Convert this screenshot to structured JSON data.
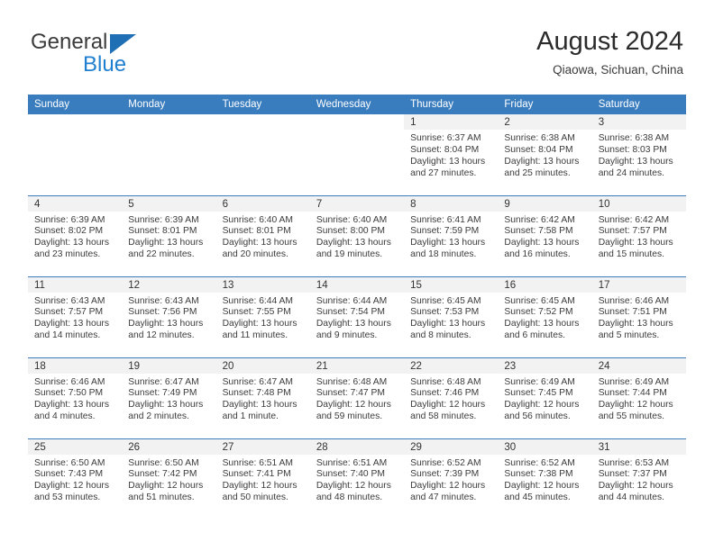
{
  "brand": {
    "line1": "General",
    "line2": "Blue",
    "triangle_icon": "brand-triangle-icon",
    "color_blue": "#1f7fd0",
    "color_dark": "#3b3b3b"
  },
  "header": {
    "title": "August 2024",
    "subtitle": "Qiaowa, Sichuan, China"
  },
  "theme": {
    "header_blue": "#3a7dbf",
    "daynum_bg": "#f2f2f2",
    "text": "#3b3b3b"
  },
  "weekdays": [
    "Sunday",
    "Monday",
    "Tuesday",
    "Wednesday",
    "Thursday",
    "Friday",
    "Saturday"
  ],
  "weeks": [
    [
      {
        "day": "",
        "sunrise": "",
        "sunset": "",
        "daylight1": "",
        "daylight2": ""
      },
      {
        "day": "",
        "sunrise": "",
        "sunset": "",
        "daylight1": "",
        "daylight2": ""
      },
      {
        "day": "",
        "sunrise": "",
        "sunset": "",
        "daylight1": "",
        "daylight2": ""
      },
      {
        "day": "",
        "sunrise": "",
        "sunset": "",
        "daylight1": "",
        "daylight2": ""
      },
      {
        "day": "1",
        "sunrise": "Sunrise: 6:37 AM",
        "sunset": "Sunset: 8:04 PM",
        "daylight1": "Daylight: 13 hours",
        "daylight2": "and 27 minutes."
      },
      {
        "day": "2",
        "sunrise": "Sunrise: 6:38 AM",
        "sunset": "Sunset: 8:04 PM",
        "daylight1": "Daylight: 13 hours",
        "daylight2": "and 25 minutes."
      },
      {
        "day": "3",
        "sunrise": "Sunrise: 6:38 AM",
        "sunset": "Sunset: 8:03 PM",
        "daylight1": "Daylight: 13 hours",
        "daylight2": "and 24 minutes."
      }
    ],
    [
      {
        "day": "4",
        "sunrise": "Sunrise: 6:39 AM",
        "sunset": "Sunset: 8:02 PM",
        "daylight1": "Daylight: 13 hours",
        "daylight2": "and 23 minutes."
      },
      {
        "day": "5",
        "sunrise": "Sunrise: 6:39 AM",
        "sunset": "Sunset: 8:01 PM",
        "daylight1": "Daylight: 13 hours",
        "daylight2": "and 22 minutes."
      },
      {
        "day": "6",
        "sunrise": "Sunrise: 6:40 AM",
        "sunset": "Sunset: 8:01 PM",
        "daylight1": "Daylight: 13 hours",
        "daylight2": "and 20 minutes."
      },
      {
        "day": "7",
        "sunrise": "Sunrise: 6:40 AM",
        "sunset": "Sunset: 8:00 PM",
        "daylight1": "Daylight: 13 hours",
        "daylight2": "and 19 minutes."
      },
      {
        "day": "8",
        "sunrise": "Sunrise: 6:41 AM",
        "sunset": "Sunset: 7:59 PM",
        "daylight1": "Daylight: 13 hours",
        "daylight2": "and 18 minutes."
      },
      {
        "day": "9",
        "sunrise": "Sunrise: 6:42 AM",
        "sunset": "Sunset: 7:58 PM",
        "daylight1": "Daylight: 13 hours",
        "daylight2": "and 16 minutes."
      },
      {
        "day": "10",
        "sunrise": "Sunrise: 6:42 AM",
        "sunset": "Sunset: 7:57 PM",
        "daylight1": "Daylight: 13 hours",
        "daylight2": "and 15 minutes."
      }
    ],
    [
      {
        "day": "11",
        "sunrise": "Sunrise: 6:43 AM",
        "sunset": "Sunset: 7:57 PM",
        "daylight1": "Daylight: 13 hours",
        "daylight2": "and 14 minutes."
      },
      {
        "day": "12",
        "sunrise": "Sunrise: 6:43 AM",
        "sunset": "Sunset: 7:56 PM",
        "daylight1": "Daylight: 13 hours",
        "daylight2": "and 12 minutes."
      },
      {
        "day": "13",
        "sunrise": "Sunrise: 6:44 AM",
        "sunset": "Sunset: 7:55 PM",
        "daylight1": "Daylight: 13 hours",
        "daylight2": "and 11 minutes."
      },
      {
        "day": "14",
        "sunrise": "Sunrise: 6:44 AM",
        "sunset": "Sunset: 7:54 PM",
        "daylight1": "Daylight: 13 hours",
        "daylight2": "and 9 minutes."
      },
      {
        "day": "15",
        "sunrise": "Sunrise: 6:45 AM",
        "sunset": "Sunset: 7:53 PM",
        "daylight1": "Daylight: 13 hours",
        "daylight2": "and 8 minutes."
      },
      {
        "day": "16",
        "sunrise": "Sunrise: 6:45 AM",
        "sunset": "Sunset: 7:52 PM",
        "daylight1": "Daylight: 13 hours",
        "daylight2": "and 6 minutes."
      },
      {
        "day": "17",
        "sunrise": "Sunrise: 6:46 AM",
        "sunset": "Sunset: 7:51 PM",
        "daylight1": "Daylight: 13 hours",
        "daylight2": "and 5 minutes."
      }
    ],
    [
      {
        "day": "18",
        "sunrise": "Sunrise: 6:46 AM",
        "sunset": "Sunset: 7:50 PM",
        "daylight1": "Daylight: 13 hours",
        "daylight2": "and 4 minutes."
      },
      {
        "day": "19",
        "sunrise": "Sunrise: 6:47 AM",
        "sunset": "Sunset: 7:49 PM",
        "daylight1": "Daylight: 13 hours",
        "daylight2": "and 2 minutes."
      },
      {
        "day": "20",
        "sunrise": "Sunrise: 6:47 AM",
        "sunset": "Sunset: 7:48 PM",
        "daylight1": "Daylight: 13 hours",
        "daylight2": "and 1 minute."
      },
      {
        "day": "21",
        "sunrise": "Sunrise: 6:48 AM",
        "sunset": "Sunset: 7:47 PM",
        "daylight1": "Daylight: 12 hours",
        "daylight2": "and 59 minutes."
      },
      {
        "day": "22",
        "sunrise": "Sunrise: 6:48 AM",
        "sunset": "Sunset: 7:46 PM",
        "daylight1": "Daylight: 12 hours",
        "daylight2": "and 58 minutes."
      },
      {
        "day": "23",
        "sunrise": "Sunrise: 6:49 AM",
        "sunset": "Sunset: 7:45 PM",
        "daylight1": "Daylight: 12 hours",
        "daylight2": "and 56 minutes."
      },
      {
        "day": "24",
        "sunrise": "Sunrise: 6:49 AM",
        "sunset": "Sunset: 7:44 PM",
        "daylight1": "Daylight: 12 hours",
        "daylight2": "and 55 minutes."
      }
    ],
    [
      {
        "day": "25",
        "sunrise": "Sunrise: 6:50 AM",
        "sunset": "Sunset: 7:43 PM",
        "daylight1": "Daylight: 12 hours",
        "daylight2": "and 53 minutes."
      },
      {
        "day": "26",
        "sunrise": "Sunrise: 6:50 AM",
        "sunset": "Sunset: 7:42 PM",
        "daylight1": "Daylight: 12 hours",
        "daylight2": "and 51 minutes."
      },
      {
        "day": "27",
        "sunrise": "Sunrise: 6:51 AM",
        "sunset": "Sunset: 7:41 PM",
        "daylight1": "Daylight: 12 hours",
        "daylight2": "and 50 minutes."
      },
      {
        "day": "28",
        "sunrise": "Sunrise: 6:51 AM",
        "sunset": "Sunset: 7:40 PM",
        "daylight1": "Daylight: 12 hours",
        "daylight2": "and 48 minutes."
      },
      {
        "day": "29",
        "sunrise": "Sunrise: 6:52 AM",
        "sunset": "Sunset: 7:39 PM",
        "daylight1": "Daylight: 12 hours",
        "daylight2": "and 47 minutes."
      },
      {
        "day": "30",
        "sunrise": "Sunrise: 6:52 AM",
        "sunset": "Sunset: 7:38 PM",
        "daylight1": "Daylight: 12 hours",
        "daylight2": "and 45 minutes."
      },
      {
        "day": "31",
        "sunrise": "Sunrise: 6:53 AM",
        "sunset": "Sunset: 7:37 PM",
        "daylight1": "Daylight: 12 hours",
        "daylight2": "and 44 minutes."
      }
    ]
  ]
}
